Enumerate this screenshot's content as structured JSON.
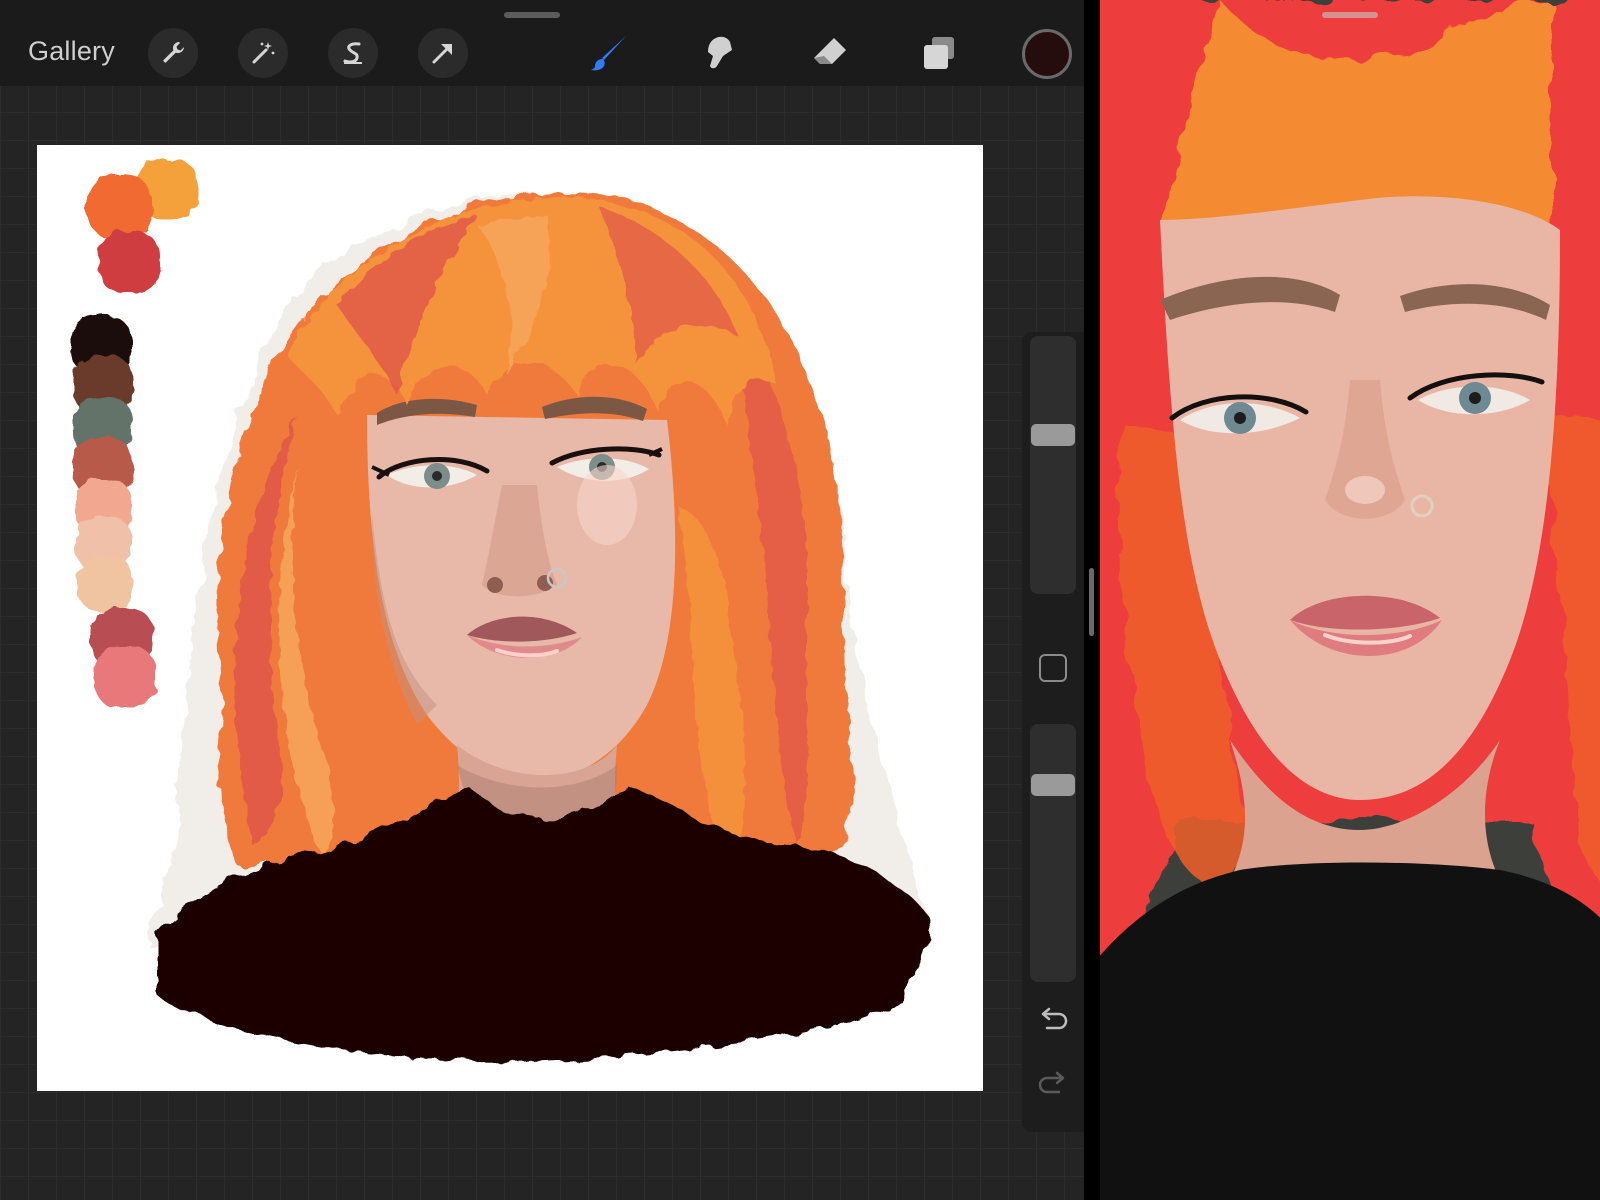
{
  "toolbar": {
    "gallery_label": "Gallery",
    "left_tools": [
      {
        "icon": "wrench-icon",
        "name": "actions"
      },
      {
        "icon": "magic-wand-icon",
        "name": "adjustments"
      },
      {
        "icon": "selection-s-icon",
        "name": "selection"
      },
      {
        "icon": "transform-arrow-icon",
        "name": "transform"
      }
    ],
    "right_tools": [
      {
        "icon": "brush-icon",
        "name": "paint",
        "active": true
      },
      {
        "icon": "smudge-icon",
        "name": "smudge",
        "active": false
      },
      {
        "icon": "eraser-icon",
        "name": "erase",
        "active": false
      },
      {
        "icon": "layers-icon",
        "name": "layers",
        "active": false
      }
    ],
    "current_color": "#250d0d",
    "active_tool_color": "#2f7df6"
  },
  "sidebar": {
    "brush_size_level": 0.63,
    "opacity_level": 0.8,
    "modifier_icon": "square-modifier-icon",
    "undo_icon": "undo-arrow-icon",
    "redo_icon": "redo-arrow-icon"
  },
  "canvas": {
    "palette_swatches": [
      "#f4a03a",
      "#f06a30",
      "#d03c40",
      "#1c0b0b",
      "#6b3b2a",
      "#64736b",
      "#b85a48",
      "#f2a890",
      "#f0c0a8",
      "#f0c4a0",
      "#b84e52",
      "#e8787a"
    ],
    "hair_colors": [
      "#f07a3a",
      "#f5933e",
      "#e0564a",
      "#f7a45a"
    ],
    "skin_color": "#e8b8a8",
    "shirt_color": "#1f0606"
  },
  "reference": {
    "background_color": "#3c3f3a",
    "hair_colors": [
      "#ee3e3c",
      "#f48a30",
      "#f0602c"
    ],
    "skin_color": "#e9b6a6",
    "shirt_color": "#111111"
  }
}
